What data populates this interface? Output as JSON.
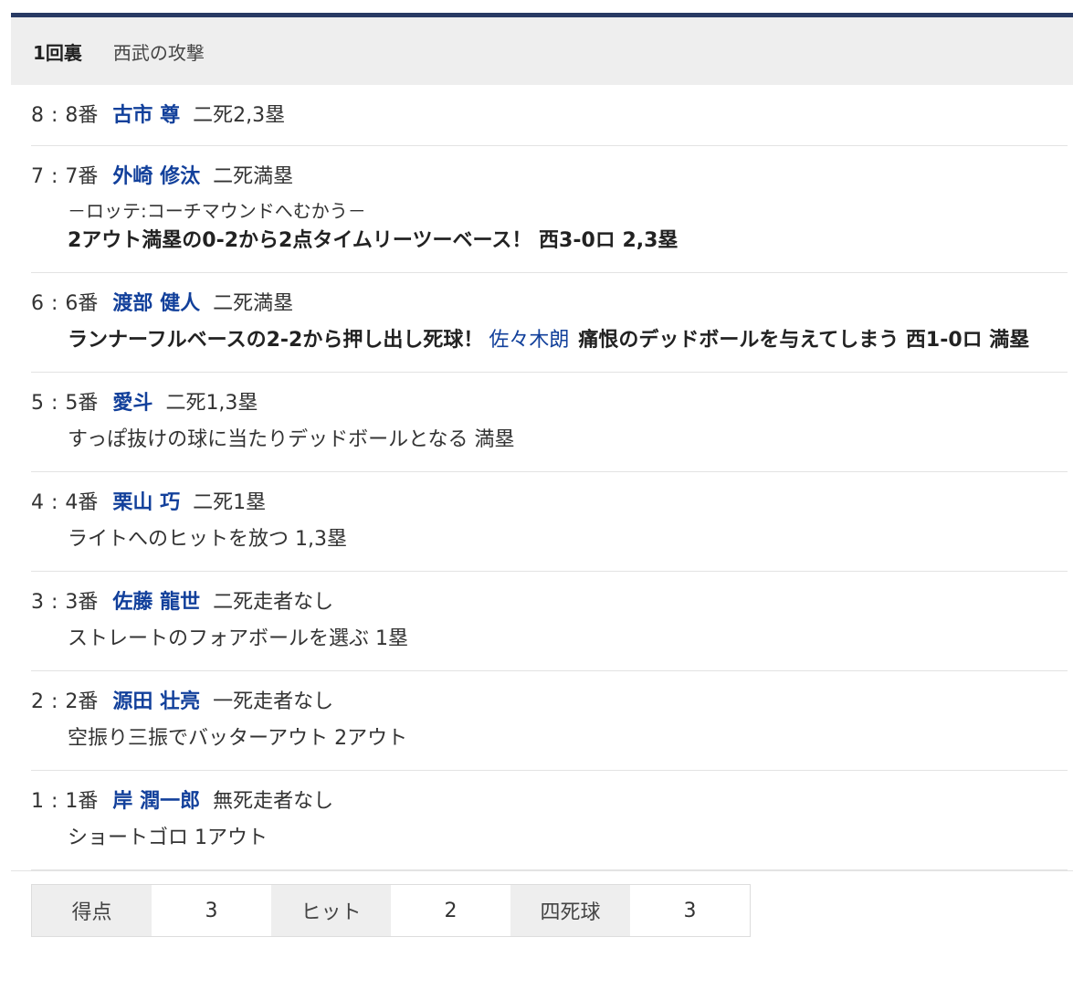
{
  "header": {
    "inning": "1回裏",
    "attack": "西武の攻撃"
  },
  "plays": [
    {
      "num": "8",
      "order": "8番",
      "batter": "古市 尊",
      "situation": "二死2,3塁",
      "lines": []
    },
    {
      "num": "7",
      "order": "7番",
      "batter": "外崎 修汰",
      "situation": "二死満塁",
      "lines": [
        {
          "type": "sub",
          "text": "－ロッテ:コーチマウンドへむかう－"
        },
        {
          "type": "bold",
          "text": "2アウト満塁の0-2から2点タイムリーツーベース！ 西3-0ロ 2,3塁"
        }
      ]
    },
    {
      "num": "6",
      "order": "6番",
      "batter": "渡部 健人",
      "situation": "二死満塁",
      "lines": [
        {
          "type": "bold-mixed",
          "before": "ランナーフルベースの2-2から押し出し死球！",
          "link": "佐々木朗",
          "after": "痛恨のデッドボールを与えてしまう 西1-0ロ 満塁"
        }
      ]
    },
    {
      "num": "5",
      "order": "5番",
      "batter": "愛斗",
      "situation": "二死1,3塁",
      "lines": [
        {
          "type": "normal",
          "text": "すっぽ抜けの球に当たりデッドボールとなる 満塁"
        }
      ]
    },
    {
      "num": "4",
      "order": "4番",
      "batter": "栗山 巧",
      "situation": "二死1塁",
      "lines": [
        {
          "type": "normal",
          "text": "ライトへのヒットを放つ 1,3塁"
        }
      ]
    },
    {
      "num": "3",
      "order": "3番",
      "batter": "佐藤 龍世",
      "situation": "二死走者なし",
      "lines": [
        {
          "type": "normal",
          "text": "ストレートのフォアボールを選ぶ 1塁"
        }
      ]
    },
    {
      "num": "2",
      "order": "2番",
      "batter": "源田 壮亮",
      "situation": "一死走者なし",
      "lines": [
        {
          "type": "normal",
          "text": "空振り三振でバッターアウト 2アウト"
        }
      ]
    },
    {
      "num": "1",
      "order": "1番",
      "batter": "岸 潤一郎",
      "situation": "無死走者なし",
      "lines": [
        {
          "type": "normal",
          "text": "ショートゴロ 1アウト"
        }
      ]
    }
  ],
  "summary": {
    "runs_label": "得点",
    "runs_value": "3",
    "hits_label": "ヒット",
    "hits_value": "2",
    "walks_label": "四死球",
    "walks_value": "3"
  }
}
